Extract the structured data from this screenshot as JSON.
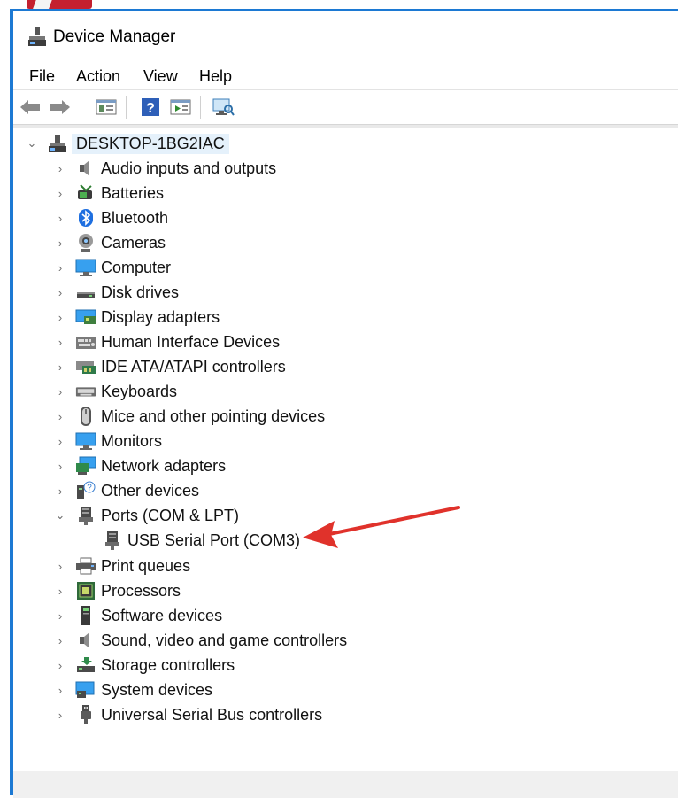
{
  "window": {
    "title": "Device Manager"
  },
  "menu": [
    "File",
    "Action",
    "View",
    "Help"
  ],
  "toolbar": {
    "icons": [
      "back-arrow-icon",
      "forward-arrow-icon",
      "properties-icon",
      "help-icon",
      "update-driver-icon",
      "scan-hardware-icon"
    ]
  },
  "tree": {
    "root": "DESKTOP-1BG2IAC",
    "items": [
      "Audio inputs and outputs",
      "Batteries",
      "Bluetooth",
      "Cameras",
      "Computer",
      "Disk drives",
      "Display adapters",
      "Human Interface Devices",
      "IDE ATA/ATAPI controllers",
      "Keyboards",
      "Mice and other pointing devices",
      "Monitors",
      "Network adapters",
      "Other devices",
      "Ports (COM & LPT)",
      "Print queues",
      "Processors",
      "Software devices",
      "Sound, video and game controllers",
      "Storage controllers",
      "System devices",
      "Universal Serial Bus controllers"
    ],
    "ports_child": "USB Serial Port (COM3)"
  },
  "colors": {
    "accent": "#1c79d3",
    "annotation": "#e0322b",
    "selection": "#e5f1fb"
  }
}
